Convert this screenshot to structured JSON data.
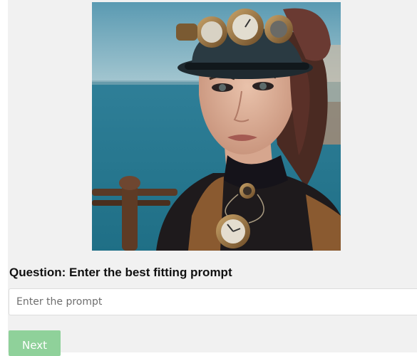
{
  "image": {
    "subject": "steampunk-woman-portrait"
  },
  "question": {
    "text": "Question: Enter the best fitting prompt"
  },
  "prompt_input": {
    "value": "",
    "placeholder": "Enter the prompt"
  },
  "next_button": {
    "label": "Next"
  },
  "colors": {
    "page_background": "#f1f1f1",
    "button_background": "#8fd19a",
    "button_text": "#ffffff"
  }
}
